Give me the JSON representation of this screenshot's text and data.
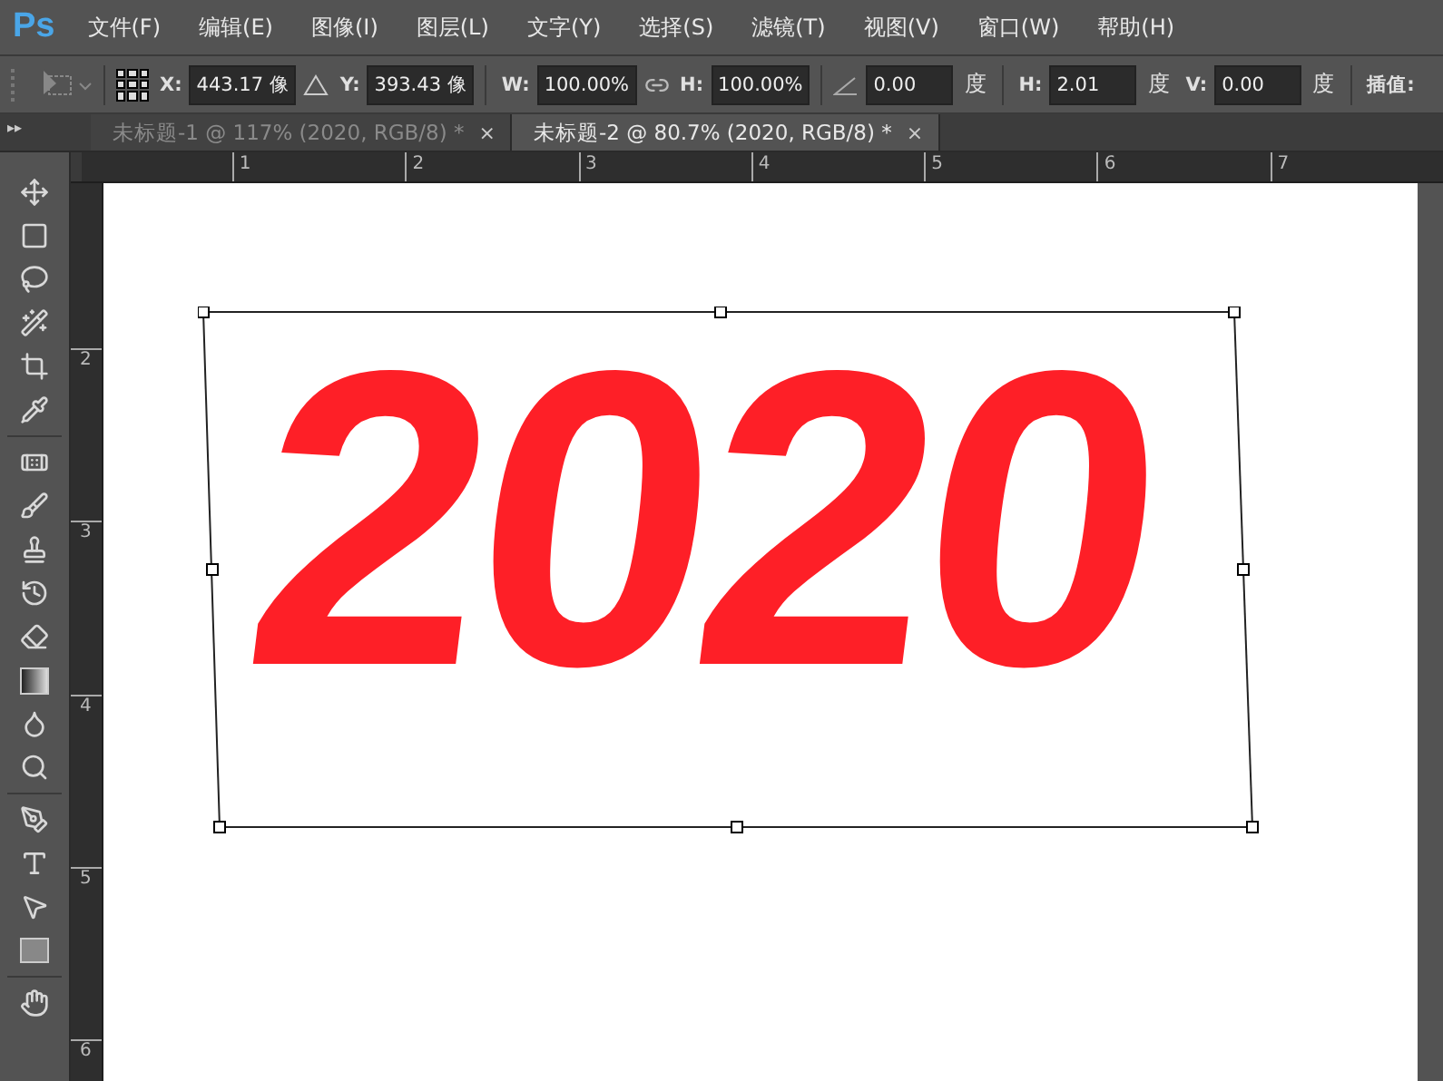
{
  "app": {
    "logo": "Ps"
  },
  "menu": [
    "文件(F)",
    "编辑(E)",
    "图像(I)",
    "图层(L)",
    "文字(Y)",
    "选择(S)",
    "滤镜(T)",
    "视图(V)",
    "窗口(W)",
    "帮助(H)"
  ],
  "options": [
    {
      "kind": "field",
      "label": "X:",
      "value": "443.17 像"
    },
    {
      "kind": "delta"
    },
    {
      "kind": "field",
      "label": "Y:",
      "value": "393.43 像"
    },
    {
      "kind": "sep"
    },
    {
      "kind": "field",
      "label": "W:",
      "value": "100.00%"
    },
    {
      "kind": "link"
    },
    {
      "kind": "field",
      "label": "H:",
      "value": "100.00%"
    },
    {
      "kind": "sep"
    },
    {
      "kind": "angle"
    },
    {
      "kind": "field",
      "value": "0.00",
      "unit": "度"
    },
    {
      "kind": "sep"
    },
    {
      "kind": "field",
      "label": "H:",
      "value": "2.01",
      "unit": "度"
    },
    {
      "kind": "field",
      "label": "V:",
      "value": "0.00",
      "unit": "度"
    },
    {
      "kind": "sep"
    },
    {
      "kind": "text",
      "label": "插值:"
    }
  ],
  "tabs": [
    {
      "label": "未标题-1 @ 117% (2020, RGB/8) *",
      "close": "×",
      "selected": false
    },
    {
      "label": "未标题-2 @ 80.7% (2020, RGB/8) *",
      "close": "×",
      "selected": true
    }
  ],
  "collapse": "▸▸",
  "ruler": {
    "horizontal": [
      "1",
      "2",
      "3",
      "4",
      "5",
      "6",
      "7"
    ],
    "vertical": [
      "2",
      "3",
      "4",
      "5",
      "6"
    ]
  },
  "canvas": {
    "text": "2020"
  }
}
